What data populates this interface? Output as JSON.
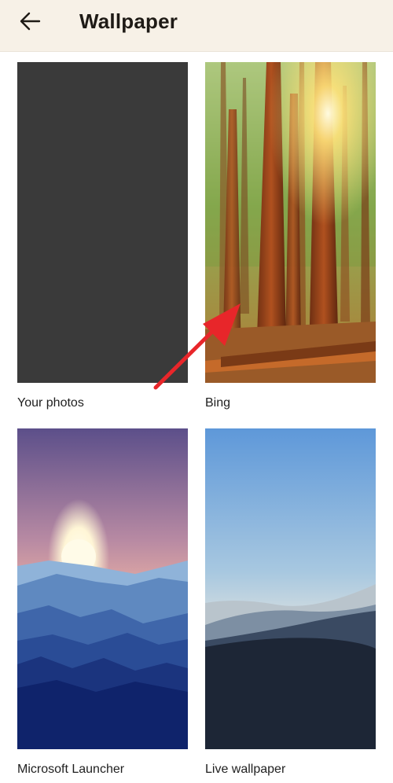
{
  "header": {
    "title": "Wallpaper",
    "back_icon": "arrow-left-icon"
  },
  "tiles": [
    {
      "label": "Your photos",
      "color": "#3a3a3a"
    },
    {
      "label": "Bing"
    },
    {
      "label": "Microsoft Launcher"
    },
    {
      "label": "Live wallpaper"
    }
  ],
  "annotation": {
    "icon": "red-arrow-icon",
    "color": "#e8262a"
  }
}
